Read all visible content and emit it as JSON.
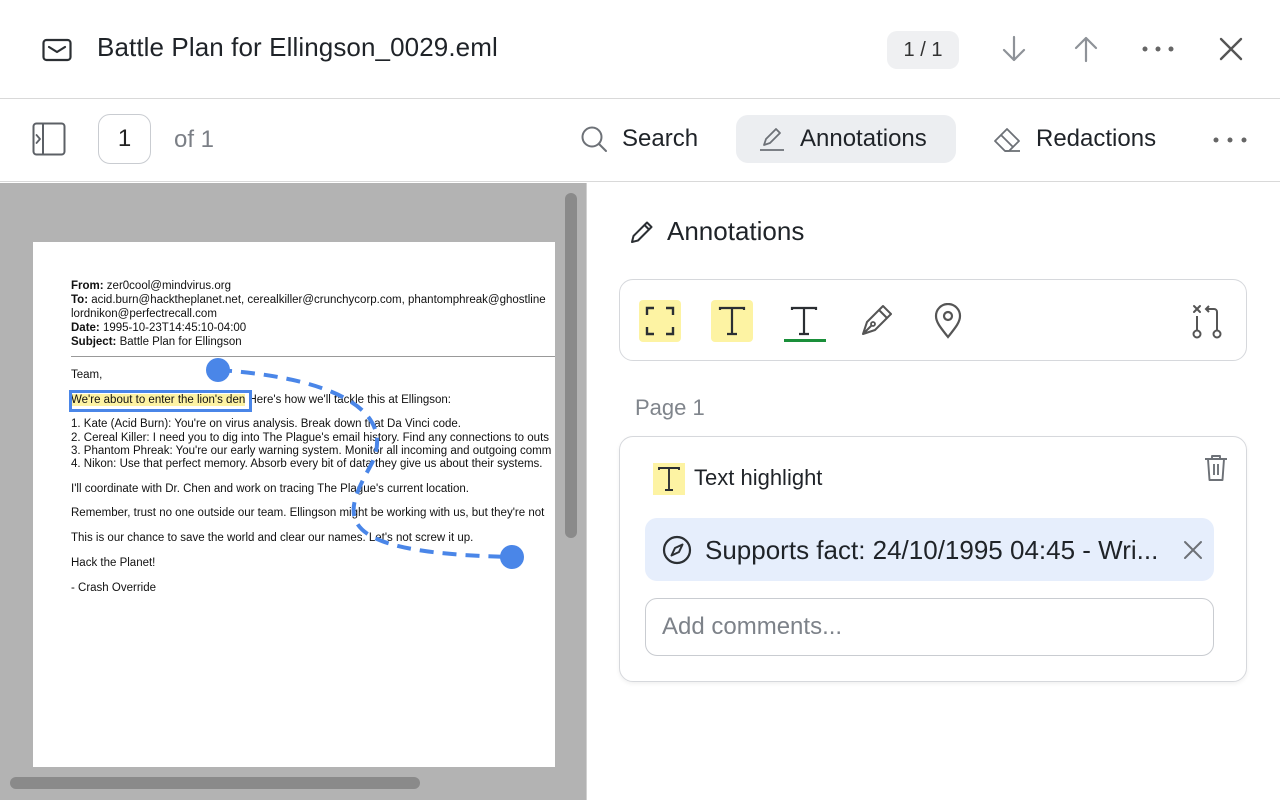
{
  "window": {
    "title": "Battle Plan for Ellingson_0029.eml",
    "match_counter": "1 / 1",
    "icons": [
      "mail-icon",
      "arrow-down-icon",
      "arrow-up-icon",
      "more-horizontal-icon",
      "close-icon"
    ]
  },
  "toolbar": {
    "page_number": "1",
    "page_of": "of 1",
    "search_label": "Search",
    "annotations_label": "Annotations",
    "redactions_label": "Redactions",
    "active_tab": "Annotations"
  },
  "document": {
    "from_label": "From:",
    "from_value": "zer0cool@mindvirus.org",
    "to_label": "To:",
    "to_value": "acid.burn@hacktheplanet.net, cerealkiller@crunchycorp.com, phantomphreak@ghostline",
    "to_value_cont": "lordnikon@perfectrecall.com",
    "date_label": "Date:",
    "date_value": "1995-10-23T14:45:10-04:00",
    "subject_label": "Subject:",
    "subject_value": "Battle Plan for Ellingson",
    "greeting": "Team,",
    "highlighted_text": "We're about to enter the lion's den",
    "after_highlight": " Here's how we'll tackle this at Ellingson:",
    "list": [
      "1. Kate (Acid Burn): You're on virus analysis. Break down that Da Vinci code.",
      "2. Cereal Killer: I need you to dig into The Plague's email history. Find any connections to outs",
      "3. Phantom Phreak: You're our early warning system. Monitor all incoming and outgoing comm",
      "4. Nikon: Use that perfect memory. Absorb every bit of data they give us about their systems."
    ],
    "para1": "I'll coordinate with Dr. Chen and work on tracing The Plague's current location.",
    "para2": "Remember, trust no one outside our team. Ellingson might be working with us, but they're not",
    "para3": "This is our chance to save the world and clear our names. Let's not screw it up.",
    "para4": "Hack the Planet!",
    "signature": "- Crash Override"
  },
  "panel": {
    "title": "Annotations",
    "tools": [
      "area-select-icon",
      "text-highlight-icon",
      "text-underline-icon",
      "pen-icon",
      "pin-icon",
      "link-nodes-icon"
    ],
    "page_label": "Page 1",
    "annotation": {
      "type_label": "Text highlight",
      "fact_text": "Supports fact: 24/10/1995 04:45 - Wri...",
      "comment_placeholder": "Add comments..."
    }
  },
  "colors": {
    "highlight": "#fdf3a3",
    "link_blue": "#4a86e8",
    "chip_bg": "#e6eefc",
    "underline_green": "#1a8f3a",
    "viewer_bg": "#b3b3b3"
  }
}
